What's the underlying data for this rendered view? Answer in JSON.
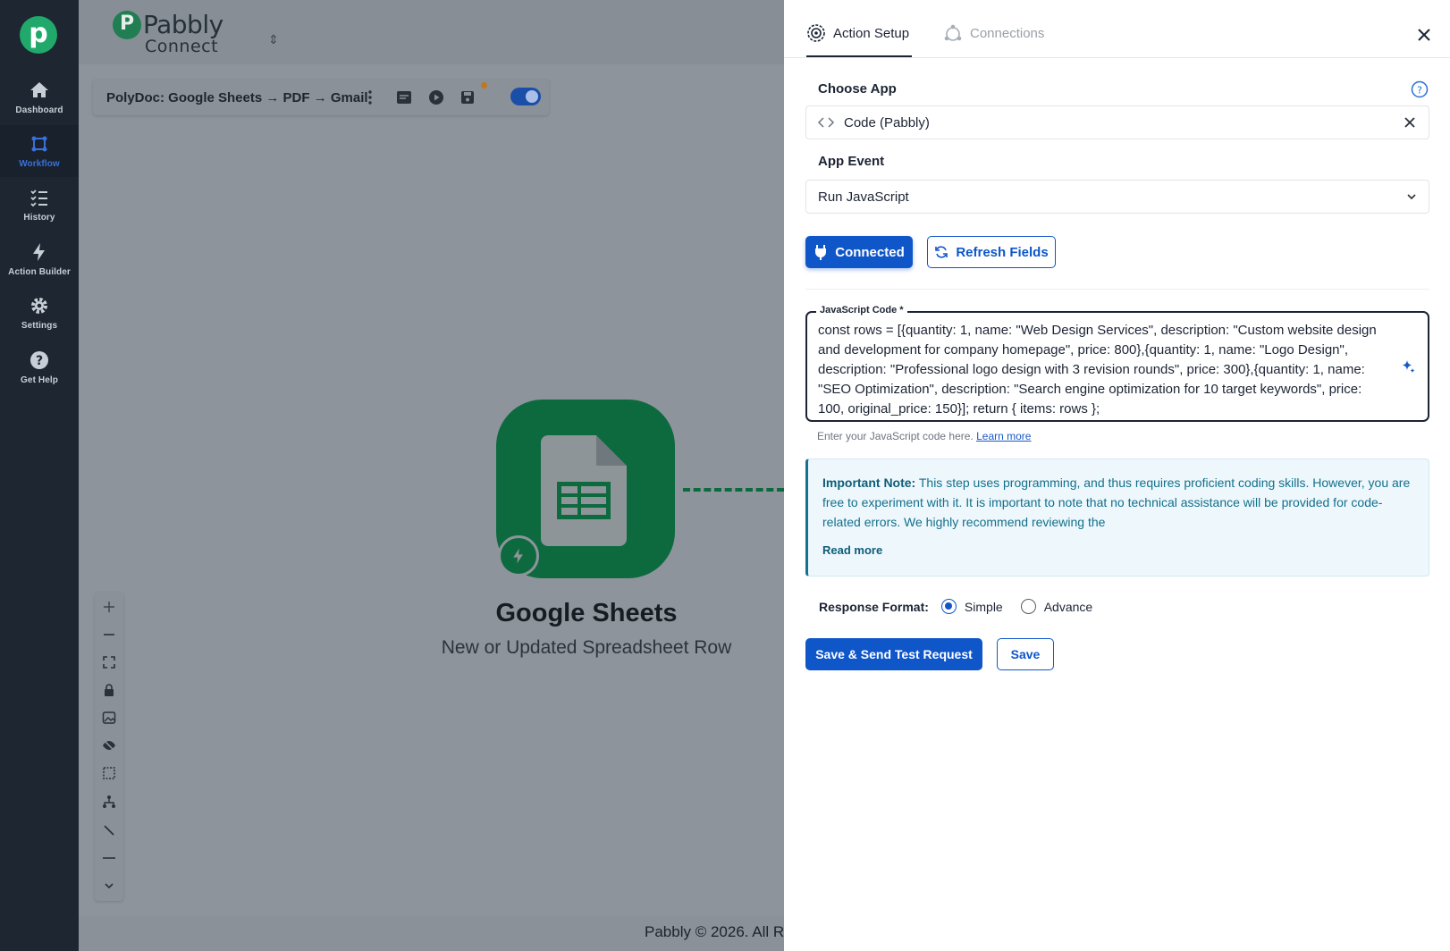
{
  "colors": {
    "sidebar_bg": "#1d2631",
    "brand_green": "#20a96b",
    "primary_blue": "#0f56c9",
    "sheets_green": "#0d6a3f",
    "note_bg": "#eef8fc"
  },
  "sidebar": {
    "logo_letter": "p",
    "items": [
      {
        "label": "Dashboard",
        "icon": "home-icon"
      },
      {
        "label": "Workflow",
        "icon": "workflow-icon",
        "active": true
      },
      {
        "label": "History",
        "icon": "history-icon"
      },
      {
        "label": "Action Builder",
        "icon": "lightning-icon"
      },
      {
        "label": "Settings",
        "icon": "gear-icon"
      },
      {
        "label": "Get Help",
        "icon": "question-icon"
      }
    ]
  },
  "canvas": {
    "brand_letter": "P",
    "brand_name": "Pabbly",
    "brand_sub": "Connect",
    "brand_switch": "⇕",
    "workflow_title": "PolyDoc: Google Sheets → PDF → Gmail",
    "node_title": "Google Sheets",
    "node_subtitle": "New or Updated Spreadsheet Row",
    "footer": "Pabbly © 2026. All Ri"
  },
  "panel": {
    "tabs": [
      {
        "label": "Action Setup",
        "active": true
      },
      {
        "label": "Connections",
        "active": false
      }
    ],
    "choose_app_label": "Choose App",
    "app_value": "Code (Pabbly)",
    "app_event_label": "App Event",
    "app_event_value": "Run JavaScript",
    "connected_label": "Connected",
    "refresh_label": "Refresh Fields",
    "code_label": "JavaScript Code *",
    "code_value": "const rows = [{quantity: 1, name: \"Web Design Services\", description: \"Custom website design and development for company homepage\", price: 800},{quantity: 1, name: \"Logo Design\", description: \"Professional logo design with 3 revision rounds\", price: 300},{quantity: 1, name: \"SEO Optimization\", description: \"Search engine optimization for 10 target keywords\", price: 100, original_price: 150}]; return { items: rows };",
    "helper_text": "Enter your JavaScript code here.",
    "helper_link": "Learn more",
    "note_title": "Important Note:",
    "note_body": "This step uses programming, and thus requires proficient coding skills. However, you are free to experiment with it. It is important to note that no technical assistance will be provided for code-related errors. We highly recommend reviewing the",
    "note_more": "Read more",
    "response_label": "Response Format:",
    "response_options": [
      "Simple",
      "Advance"
    ],
    "response_selected": "Simple",
    "primary_button": "Save & Send Test Request",
    "save_button": "Save"
  }
}
